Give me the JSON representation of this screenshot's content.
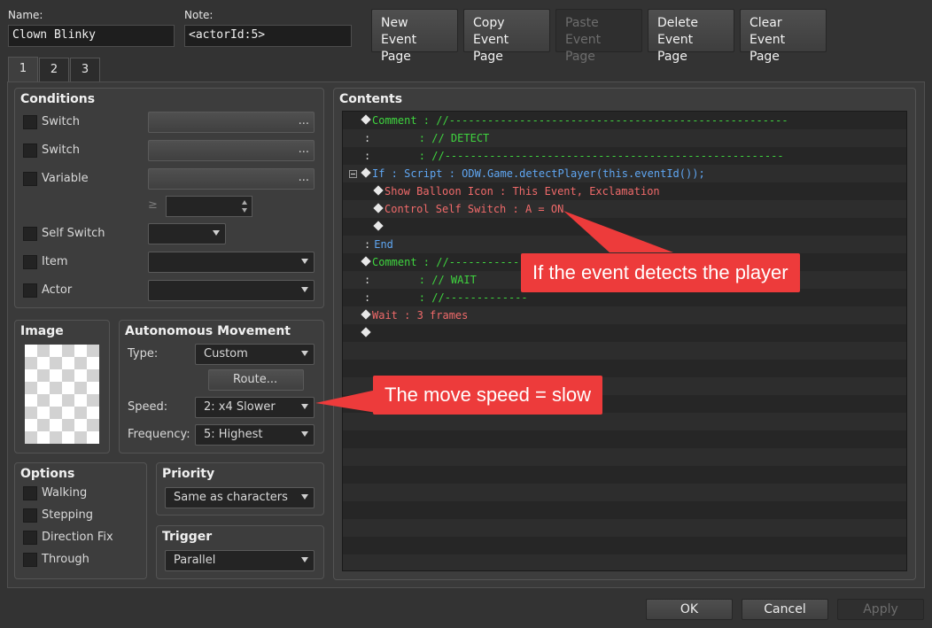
{
  "header": {
    "name_label": "Name:",
    "name_value": "Clown Blinky",
    "note_label": "Note:",
    "note_value": "<actorId:5>"
  },
  "toolbar": {
    "new_page": "New\nEvent Page",
    "copy_page": "Copy\nEvent Page",
    "paste_page": "Paste\nEvent Page",
    "delete_page": "Delete\nEvent Page",
    "clear_page": "Clear\nEvent Page"
  },
  "tabs": [
    "1",
    "2",
    "3"
  ],
  "conditions": {
    "title": "Conditions",
    "switch1": "Switch",
    "switch2": "Switch",
    "variable": "Variable",
    "geq": "≥",
    "self_switch": "Self Switch",
    "item": "Item",
    "actor": "Actor",
    "dots": "..."
  },
  "image": {
    "title": "Image"
  },
  "movement": {
    "title": "Autonomous Movement",
    "type_label": "Type:",
    "type_value": "Custom",
    "route_button": "Route...",
    "speed_label": "Speed:",
    "speed_value": "2: x4 Slower",
    "frequency_label": "Frequency:",
    "frequency_value": "5: Highest"
  },
  "options": {
    "title": "Options",
    "walking": "Walking",
    "stepping": "Stepping",
    "direction_fix": "Direction Fix",
    "through": "Through"
  },
  "priority": {
    "title": "Priority",
    "value": "Same as characters"
  },
  "trigger": {
    "title": "Trigger",
    "value": "Parallel"
  },
  "contents": {
    "title": "Contents",
    "lines": [
      {
        "color": "g",
        "diamond": true,
        "text": "Comment : //-----------------------------------------------------"
      },
      {
        "color": "g",
        "prefix": ":",
        "text": "       : // DETECT"
      },
      {
        "color": "g",
        "prefix": ":",
        "text": "       : //-----------------------------------------------------"
      },
      {
        "color": "b",
        "diamond": true,
        "text": "If : Script : ODW.Game.detectPlayer(this.eventId());"
      },
      {
        "color": "r",
        "diamond": true,
        "text": "Show Balloon Icon : This Event, Exclamation"
      },
      {
        "color": "r",
        "diamond": true,
        "text": "Control Self Switch : A = ON"
      },
      {
        "color": "w",
        "diamond": true,
        "text": ""
      },
      {
        "color": "b",
        "prefix": ":",
        "text": "End"
      },
      {
        "color": "g",
        "diamond": true,
        "text": "Comment : //-------------"
      },
      {
        "color": "g",
        "prefix": ":",
        "text": "       : // WAIT"
      },
      {
        "color": "g",
        "prefix": ":",
        "text": "       : //-------------"
      },
      {
        "color": "r",
        "diamond": true,
        "text": "Wait : 3 frames"
      },
      {
        "color": "w",
        "diamond": true,
        "text": ""
      }
    ]
  },
  "annotations": {
    "detect": "If the event detects the player",
    "speed": "The move speed = slow"
  },
  "footer": {
    "ok": "OK",
    "cancel": "Cancel",
    "apply": "Apply"
  }
}
